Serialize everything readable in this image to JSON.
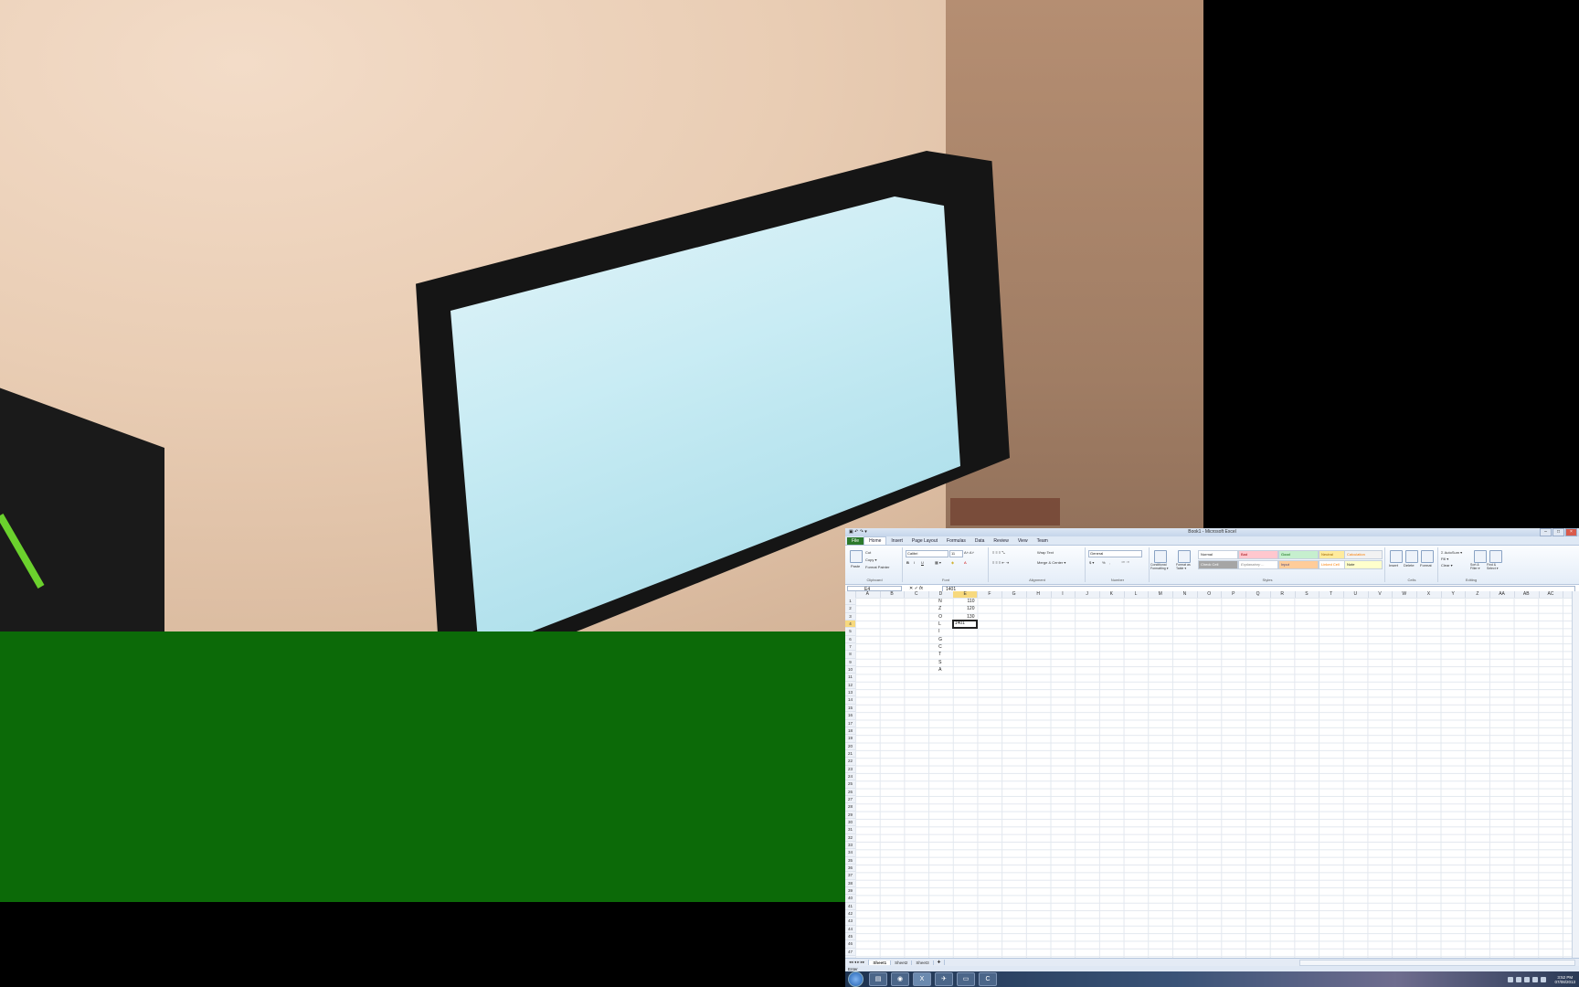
{
  "window": {
    "title": "Book1 - Microsoft Excel",
    "controls": [
      "–",
      "□",
      "×"
    ]
  },
  "ribbon_tabs": [
    "File",
    "Home",
    "Insert",
    "Page Layout",
    "Formulas",
    "Data",
    "Review",
    "View",
    "Team"
  ],
  "ribbon": {
    "clipboard": {
      "paste": "Paste",
      "cut": "Cut",
      "copy": "Copy ▾",
      "format_painter": "Format Painter",
      "label": "Clipboard"
    },
    "font": {
      "name": "Calibri",
      "size": "11",
      "bold": "B",
      "italic": "I",
      "underline": "U",
      "label": "Font"
    },
    "alignment": {
      "wrap": "Wrap Text",
      "merge": "Merge & Center ▾",
      "label": "Alignment"
    },
    "number": {
      "format": "General",
      "currency": "$ ▾",
      "percent": "%",
      "comma": ",",
      "label": "Number"
    },
    "styles": {
      "conditional": "Conditional Formatting ▾",
      "format_table": "Format as Table ▾",
      "cells": [
        "Normal",
        "Bad",
        "Good",
        "Neutral",
        "Calculation",
        "Check Cell",
        "Explanatory ...",
        "Input",
        "Linked Cell",
        "Note"
      ],
      "label": "Styles"
    },
    "cells": {
      "insert": "Insert",
      "delete": "Delete",
      "format": "Format",
      "label": "Cells"
    },
    "editing": {
      "autosum": "Σ AutoSum ▾",
      "fill": "Fill ▾",
      "clear": "Clear ▾",
      "sort": "Sort & Filter ▾",
      "find": "Find & Select ▾",
      "label": "Editing"
    }
  },
  "formula_bar": {
    "name_box": "E4",
    "fx": "fx",
    "content": "1401"
  },
  "columns": [
    "A",
    "B",
    "C",
    "D",
    "E",
    "F",
    "G",
    "H",
    "I",
    "J",
    "K",
    "L",
    "M",
    "N",
    "O",
    "P",
    "Q",
    "R",
    "S",
    "T",
    "U",
    "V",
    "W",
    "X",
    "Y",
    "Z",
    "AA",
    "AB",
    "AC"
  ],
  "rows_count": 47,
  "cells": {
    "D": [
      "N",
      "Z",
      "O",
      "L",
      "I",
      "G",
      "C",
      "T",
      "S",
      "A"
    ],
    "E": [
      "110",
      "120",
      "130"
    ]
  },
  "active_cell": {
    "ref": "E4",
    "value": "1401"
  },
  "sheets": [
    "Sheet1",
    "Sheet2",
    "Sheet3"
  ],
  "status": "Enter",
  "taskbar": {
    "icons": [
      "explorer",
      "chrome",
      "excel",
      "app",
      "terminal",
      "camtasia"
    ],
    "time": "3:52 PM",
    "date": "07/08/2013"
  }
}
